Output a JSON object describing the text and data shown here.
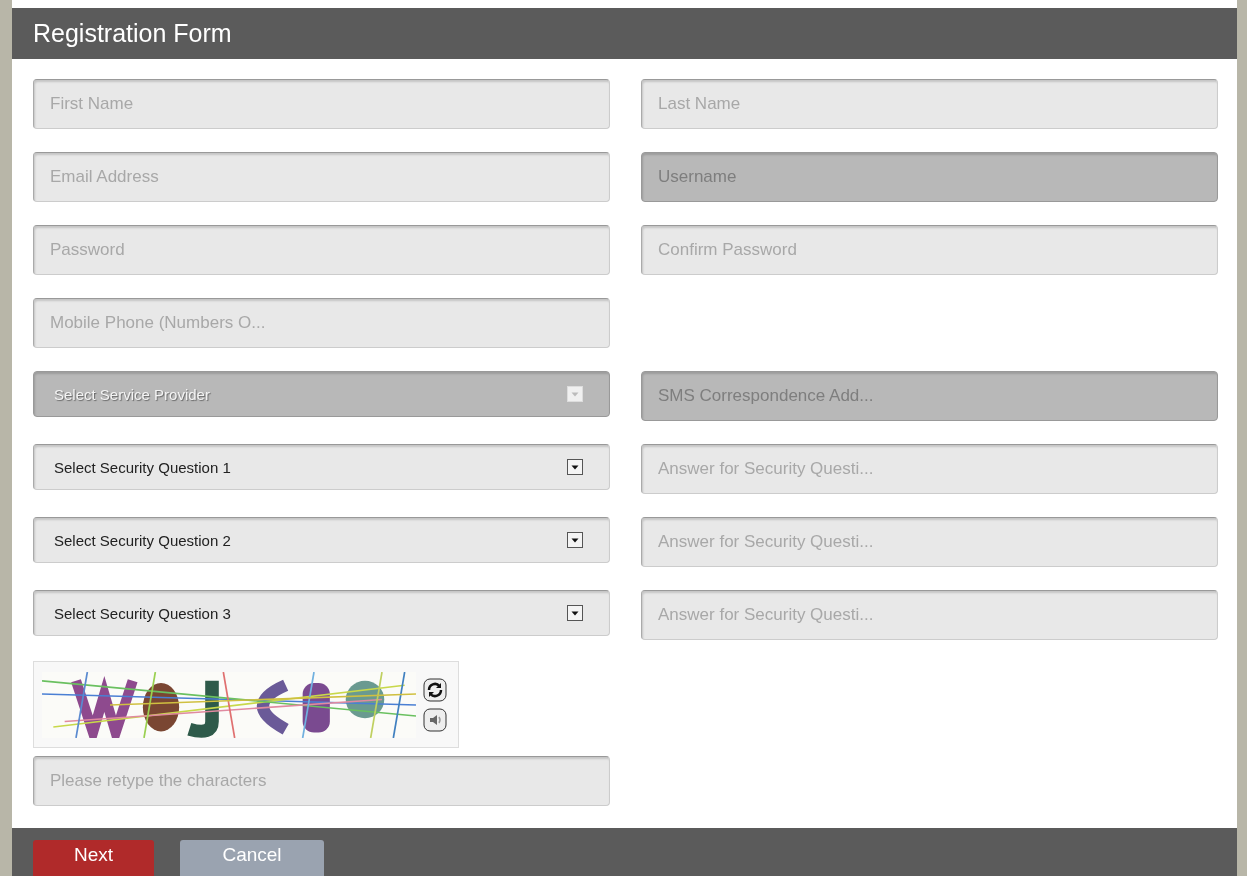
{
  "form": {
    "title": "Registration Form"
  },
  "rows": [
    {
      "cells": [
        {
          "kind": "text",
          "placeholder": "First Name",
          "disabled": false
        },
        {
          "kind": "text",
          "placeholder": "Last Name",
          "disabled": false
        }
      ]
    },
    {
      "cells": [
        {
          "kind": "text",
          "placeholder": "Email Address",
          "disabled": false
        },
        {
          "kind": "text",
          "placeholder": "Username",
          "disabled": true
        }
      ]
    },
    {
      "cells": [
        {
          "kind": "text",
          "placeholder": "Password",
          "disabled": false
        },
        {
          "kind": "text",
          "placeholder": "Confirm Password",
          "disabled": false
        }
      ]
    },
    {
      "cells": [
        {
          "kind": "text",
          "placeholder": "Mobile Phone (Numbers O...",
          "disabled": false
        }
      ]
    },
    {
      "cells": [
        {
          "kind": "select",
          "value": "Select Service Provider",
          "disabled": true
        },
        {
          "kind": "text",
          "placeholder": "SMS Correspondence Add...",
          "disabled": true
        }
      ]
    },
    {
      "cells": [
        {
          "kind": "select",
          "value": "Select Security Question 1",
          "disabled": false
        },
        {
          "kind": "text",
          "placeholder": "Answer for Security Questi...",
          "disabled": false
        }
      ]
    },
    {
      "cells": [
        {
          "kind": "select",
          "value": "Select Security Question 2",
          "disabled": false
        },
        {
          "kind": "text",
          "placeholder": "Answer for Security Questi...",
          "disabled": false
        }
      ]
    },
    {
      "cells": [
        {
          "kind": "select",
          "value": "Select Security Question 3",
          "disabled": false
        },
        {
          "kind": "text",
          "placeholder": "Answer for Security Questi...",
          "disabled": false
        }
      ]
    }
  ],
  "captcha": {
    "input": {
      "placeholder": "Please retype the characters"
    }
  },
  "buttons": [
    {
      "label": "Next",
      "kind": "primary"
    },
    {
      "label": "Cancel",
      "kind": "secondary"
    }
  ]
}
